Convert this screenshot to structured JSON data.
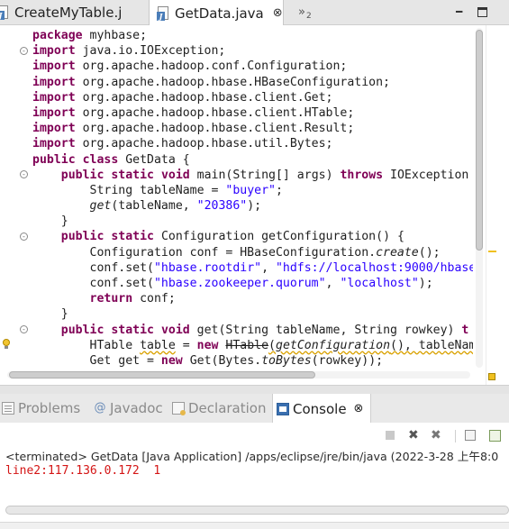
{
  "editor_tabs": [
    {
      "label": "CreateMyTable.j",
      "active": false
    },
    {
      "label": "GetData.java",
      "active": true,
      "close": "⊗"
    }
  ],
  "overflow": {
    "chevron": "»",
    "count": "2"
  },
  "window_controls": {
    "minimize": "━"
  },
  "code_lines": [
    "package myhbase;",
    "import java.io.IOException;",
    "import org.apache.hadoop.conf.Configuration;",
    "import org.apache.hadoop.hbase.HBaseConfiguration;",
    "import org.apache.hadoop.hbase.client.Get;",
    "import org.apache.hadoop.hbase.client.HTable;",
    "import org.apache.hadoop.hbase.client.Result;",
    "import org.apache.hadoop.hbase.util.Bytes;",
    "public class GetData {",
    "    public static void main(String[] args) throws IOException",
    "        String tableName = \"buyer\";",
    "        get(tableName, \"20386\");",
    "    }",
    "    public static Configuration getConfiguration() {",
    "        Configuration conf = HBaseConfiguration.create();",
    "        conf.set(\"hbase.rootdir\", \"hdfs://localhost:9000/hbase",
    "        conf.set(\"hbase.zookeeper.quorum\", \"localhost\");",
    "        return conf;",
    "    }",
    "    public static void get(String tableName, String rowkey) t",
    "        HTable table = new HTable(getConfiguration(), tableNam",
    "        Get get = new Get(Bytes.toBytes(rowkey));"
  ],
  "view_tabs": {
    "problems": "Problems",
    "javadoc": "Javadoc",
    "declaration": "Declaration",
    "console": "Console",
    "console_close": "⊗",
    "javadoc_icon": "@"
  },
  "console_toolbar": {
    "remove": "✖",
    "remove_all": "✖"
  },
  "console": {
    "terminated": "<terminated> GetData [Java Application] /apps/eclipse/jre/bin/java (2022-3-28 上午8:0",
    "output": "line2:117.136.0.172  1"
  },
  "colors": {
    "keyword": "#7f0055",
    "string": "#2a00ff",
    "console_output": "#d41515",
    "warning": "#d9a100"
  },
  "icons": [
    "java-file-icon",
    "fold-icon",
    "warning-bulb-icon",
    "problems-icon",
    "javadoc-icon",
    "declaration-icon",
    "console-icon"
  ]
}
